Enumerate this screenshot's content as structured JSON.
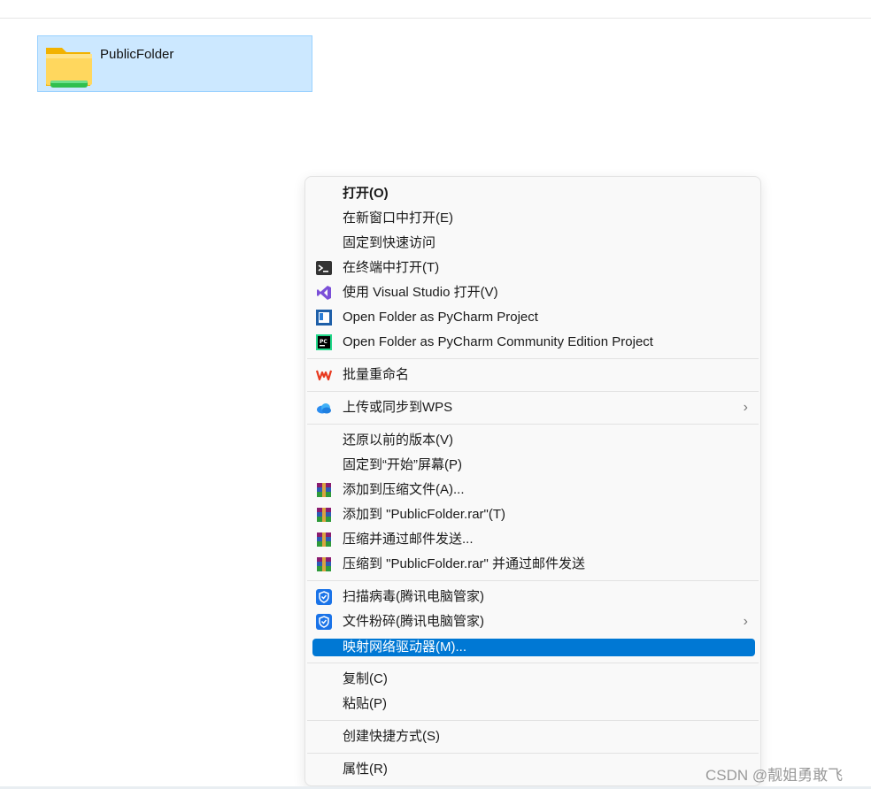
{
  "folder": {
    "name": "PublicFolder",
    "icon": "folder-icon"
  },
  "menu": {
    "items": [
      {
        "label": "打开(O)",
        "icon": null,
        "bold": true
      },
      {
        "label": "在新窗口中打开(E)",
        "icon": null
      },
      {
        "label": "固定到快速访问",
        "icon": null
      },
      {
        "label": "在终端中打开(T)",
        "icon": "terminal-icon"
      },
      {
        "label": "使用 Visual Studio 打开(V)",
        "icon": "visual-studio-icon"
      },
      {
        "label": "Open Folder as PyCharm Project",
        "icon": "pycharm-icon"
      },
      {
        "label": "Open Folder as PyCharm Community Edition Project",
        "icon": "pycharm-ce-icon"
      },
      {
        "label": "批量重命名",
        "icon": "wps-icon"
      },
      {
        "label": "上传或同步到WPS",
        "icon": "cloud-icon",
        "submenu": true
      },
      {
        "label": "还原以前的版本(V)",
        "icon": null
      },
      {
        "label": "固定到“开始”屏幕(P)",
        "icon": null
      },
      {
        "label": "添加到压缩文件(A)...",
        "icon": "winrar-icon"
      },
      {
        "label": "添加到 \"PublicFolder.rar\"(T)",
        "icon": "winrar-icon"
      },
      {
        "label": "压缩并通过邮件发送...",
        "icon": "winrar-icon"
      },
      {
        "label": "压缩到 \"PublicFolder.rar\" 并通过邮件发送",
        "icon": "winrar-icon"
      },
      {
        "label": "扫描病毒(腾讯电脑管家)",
        "icon": "tencent-shield-icon"
      },
      {
        "label": "文件粉碎(腾讯电脑管家)",
        "icon": "tencent-shield-icon",
        "submenu": true
      },
      {
        "label": "映射网络驱动器(M)...",
        "icon": null,
        "highlighted": true
      },
      {
        "label": "复制(C)",
        "icon": null
      },
      {
        "label": "粘贴(P)",
        "icon": null
      },
      {
        "label": "创建快捷方式(S)",
        "icon": null
      },
      {
        "label": "属性(R)",
        "icon": null
      }
    ],
    "chevron": "›",
    "highlight_color": "#0078d4"
  },
  "watermark": "CSDN @靓姐勇敢飞"
}
